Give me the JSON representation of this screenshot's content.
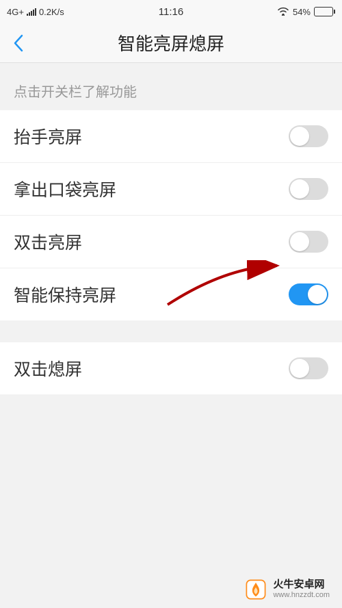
{
  "statusBar": {
    "network": "4G+",
    "speed": "0.2K/s",
    "time": "11:16",
    "batteryPercent": "54%"
  },
  "nav": {
    "title": "智能亮屏熄屏"
  },
  "sectionHeader": "点击开关栏了解功能",
  "settings": [
    {
      "label": "抬手亮屏",
      "on": false
    },
    {
      "label": "拿出口袋亮屏",
      "on": false
    },
    {
      "label": "双击亮屏",
      "on": false
    },
    {
      "label": "智能保持亮屏",
      "on": true
    }
  ],
  "settings2": [
    {
      "label": "双击熄屏",
      "on": false
    }
  ],
  "watermark": {
    "title": "火牛安卓网",
    "url": "www.hnzzdt.com"
  }
}
